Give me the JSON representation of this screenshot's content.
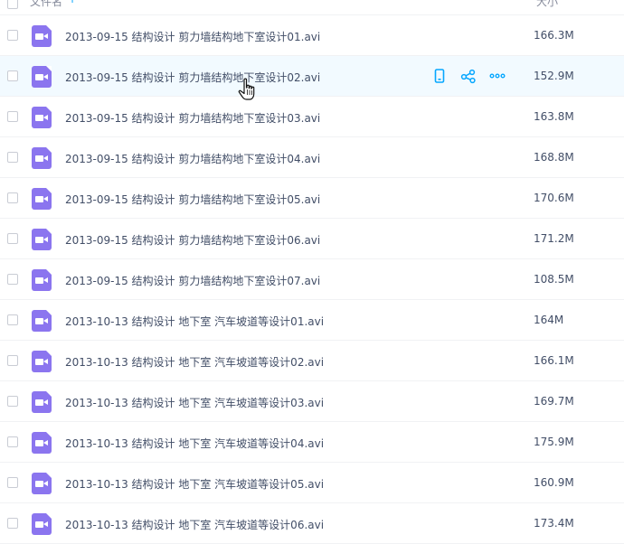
{
  "header": {
    "name_label": "文件名",
    "sort_arrow": "↑",
    "size_label": "大小"
  },
  "files": [
    {
      "name": "2013-09-15 结构设计 剪力墙结构地下室设计01.avi",
      "size": "166.3M"
    },
    {
      "name": "2013-09-15 结构设计 剪力墙结构地下室设计02.avi",
      "size": "152.9M",
      "hovered": true
    },
    {
      "name": "2013-09-15 结构设计 剪力墙结构地下室设计03.avi",
      "size": "163.8M"
    },
    {
      "name": "2013-09-15 结构设计 剪力墙结构地下室设计04.avi",
      "size": "168.8M"
    },
    {
      "name": "2013-09-15 结构设计 剪力墙结构地下室设计05.avi",
      "size": "170.6M"
    },
    {
      "name": "2013-09-15 结构设计 剪力墙结构地下室设计06.avi",
      "size": "171.2M"
    },
    {
      "name": "2013-09-15 结构设计 剪力墙结构地下室设计07.avi",
      "size": "108.5M"
    },
    {
      "name": "2013-10-13 结构设计 地下室 汽车坡道等设计01.avi",
      "size": "164M"
    },
    {
      "name": "2013-10-13 结构设计 地下室 汽车坡道等设计02.avi",
      "size": "166.1M"
    },
    {
      "name": "2013-10-13 结构设计 地下室 汽车坡道等设计03.avi",
      "size": "169.7M"
    },
    {
      "name": "2013-10-13 结构设计 地下室 汽车坡道等设计04.avi",
      "size": "175.9M"
    },
    {
      "name": "2013-10-13 结构设计 地下室 汽车坡道等设计05.avi",
      "size": "160.9M"
    },
    {
      "name": "2013-10-13 结构设计 地下室 汽车坡道等设计06.avi",
      "size": "173.4M"
    }
  ],
  "row_actions": [
    "phone-icon",
    "share-icon",
    "more-icon"
  ],
  "colors": {
    "video_icon": "#8b75ef",
    "action_icon": "#06a7ff",
    "hover_row": "#f2faff",
    "text": "#424e67"
  }
}
